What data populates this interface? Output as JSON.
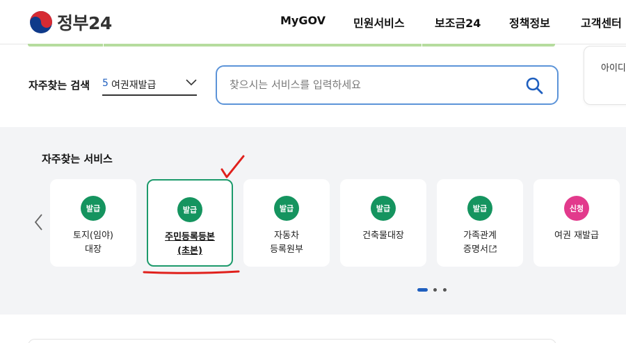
{
  "header": {
    "logo_text": "정부24",
    "nav": [
      "MyGOV",
      "민원서비스",
      "보조금24",
      "정책정보",
      "고객센터"
    ]
  },
  "login": {
    "text": "아이디"
  },
  "search": {
    "label": "자주찾는 검색",
    "select_number": "5",
    "select_value": "여권재발급",
    "placeholder": "찾으시는 서비스를 입력하세요",
    "button_icon": "search-icon"
  },
  "services": {
    "title": "자주찾는 서비스",
    "items": [
      {
        "badge": "발급",
        "line1": "토지(임야)",
        "line2": "대장",
        "external": false
      },
      {
        "badge": "발급",
        "line1": "주민등록등본",
        "line2": "(초본)",
        "external": false,
        "selected": true
      },
      {
        "badge": "발급",
        "line1": "자동차",
        "line2": "등록원부",
        "external": false
      },
      {
        "badge": "발급",
        "line1": "건축물대장",
        "line2": "",
        "external": false
      },
      {
        "badge": "발급",
        "line1": "가족관계",
        "line2": "증명서",
        "external": true
      },
      {
        "badge": "신청",
        "line1": "여권 재발급",
        "line2": "",
        "external": false
      }
    ],
    "page_count": 3,
    "current_page": 1
  },
  "colors": {
    "accent_blue": "#1f5fbf",
    "badge_green": "#15945f",
    "badge_pink": "#e23a8c",
    "selected_border": "#1c9a6b",
    "annotation_red": "#e0201c"
  }
}
